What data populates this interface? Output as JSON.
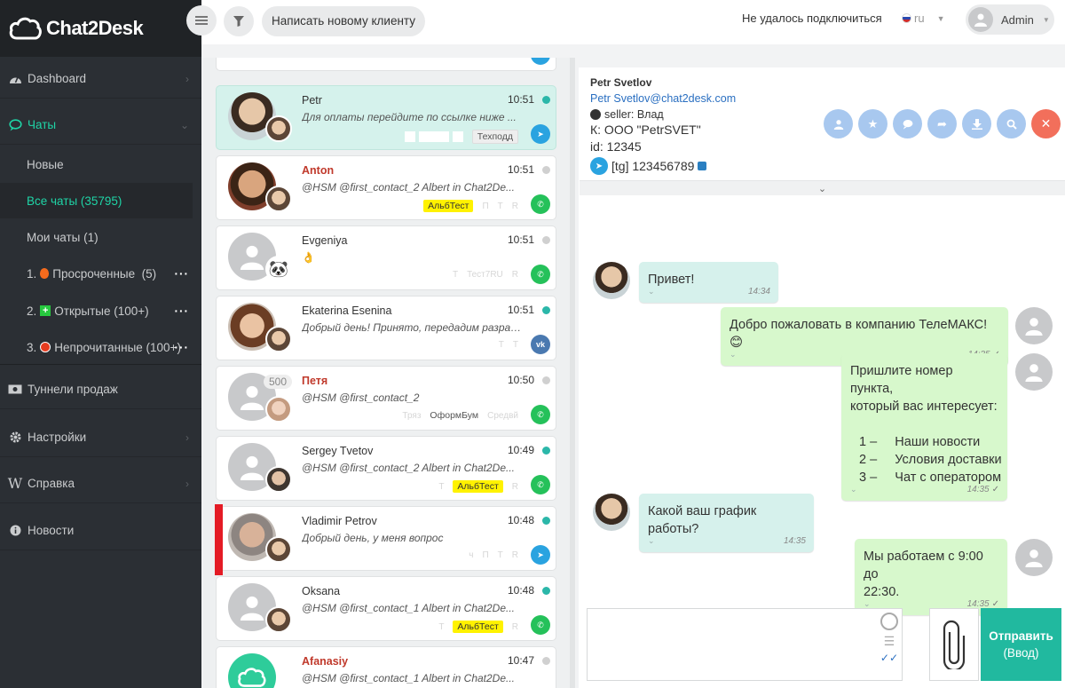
{
  "app": {
    "name": "Chat2Desk"
  },
  "sidebar": {
    "items": [
      {
        "label": "Dashboard",
        "icon": "dashboard-icon"
      },
      {
        "label": "Чаты",
        "icon": "chat-bubble-icon"
      },
      {
        "label": "Туннели продаж",
        "icon": "money-icon"
      },
      {
        "label": "Настройки",
        "icon": "gear-icon"
      },
      {
        "label": "Справка",
        "icon": "wiki-icon"
      },
      {
        "label": "Новости",
        "icon": "info-icon"
      }
    ],
    "chats_sub": [
      {
        "label": "Новые"
      },
      {
        "label": "Все чаты (35795)"
      },
      {
        "label": "Мои чаты (1)"
      },
      {
        "prefix": "1.",
        "label": "Просроченные  (5)",
        "more": "···"
      },
      {
        "prefix": "2.",
        "label": "Открытые (100+)",
        "more": "···"
      },
      {
        "prefix": "3.",
        "label": "Непрочитанные (100+)",
        "more": "···"
      }
    ]
  },
  "topbar": {
    "new_client": "Написать новому клиенту",
    "connection_status": "Не удалось подключиться",
    "lang": "ru",
    "user": "Admin"
  },
  "chats": [
    {
      "name": "Petr",
      "time": "10:51",
      "preview": "Для оплаты перейдите по ссылке ниже ...",
      "tag": "Техподд",
      "channel": "telegram"
    },
    {
      "name": "Anton",
      "time": "10:51",
      "preview": "@HSM @first_contact_2 Albert in Chat2De...",
      "tag": "АльбТест",
      "faded": [
        "П",
        "Т",
        "R"
      ],
      "channel": "whatsapp"
    },
    {
      "name": "Evgeniya",
      "time": "10:51",
      "preview": "👌",
      "faded": [
        "Т",
        "Тест7RU",
        "R"
      ],
      "channel": "whatsapp"
    },
    {
      "name": "Ekaterina Esenina",
      "time": "10:51",
      "preview": "Добрый день! Принято, передадим разрабо...",
      "faded": [
        "Т",
        "Т"
      ],
      "channel": "vk"
    },
    {
      "name": "Петя",
      "time": "10:50",
      "preview": "@HSM @first_contact_2",
      "badge": "500",
      "tag": "ОформБум",
      "faded": [
        "Тряз",
        "Средвй"
      ],
      "channel": "whatsapp"
    },
    {
      "name": "Sergey Tvetov",
      "time": "10:49",
      "preview": "@HSM @first_contact_2 Albert in Chat2De...",
      "tag": "АльбТест",
      "faded": [
        "Т",
        "R"
      ],
      "channel": "whatsapp"
    },
    {
      "name": "Vladimir Petrov",
      "time": "10:48",
      "preview": "Добрый день, у меня вопрос",
      "faded": [
        "ч",
        "П",
        "Т",
        "R"
      ],
      "channel": "telegram"
    },
    {
      "name": "Oksana",
      "time": "10:48",
      "preview": "@HSM @first_contact_1 Albert in Chat2De...",
      "tag": "АльбТест",
      "faded": [
        "Т",
        "R"
      ],
      "channel": "whatsapp"
    },
    {
      "name": "Afanasiy",
      "time": "10:47",
      "preview": "@HSM @first_contact_1 Albert in Chat2De...",
      "channel": "whatsapp"
    }
  ],
  "client": {
    "name": "Petr Svetlov",
    "email": "Petr Svetlov@chat2desk.com",
    "seller": "seller: Влад",
    "company": "К: ООО \"PetrSVET\"",
    "id": "id: 12345",
    "tg": "[tg] 123456789"
  },
  "messages": [
    {
      "dir": "in",
      "text": "Привет!",
      "time": "14:34"
    },
    {
      "dir": "out",
      "text": "Добро пожаловать в компанию ТелеМАКС!😊",
      "time": "14:35"
    },
    {
      "dir": "out",
      "lines": [
        "Пришлите номер пункта,",
        "который вас интересует:",
        "",
        "1 –     Наши новости",
        "2 –     Условия доставки",
        "3 –     Чат с оператором"
      ],
      "time": "14:35"
    },
    {
      "dir": "in",
      "text": "Какой ваш график работы?",
      "time": "14:35"
    },
    {
      "dir": "out",
      "lines": [
        "Мы работаем с 9:00 до",
        "22:30."
      ],
      "time": "14:35"
    }
  ],
  "composer": {
    "send": "Отправить",
    "send_sub": "(Ввод)"
  },
  "colors": {
    "accent": "#21b99f",
    "sidebar": "#2b2f34",
    "active": "#1fd4a6"
  }
}
